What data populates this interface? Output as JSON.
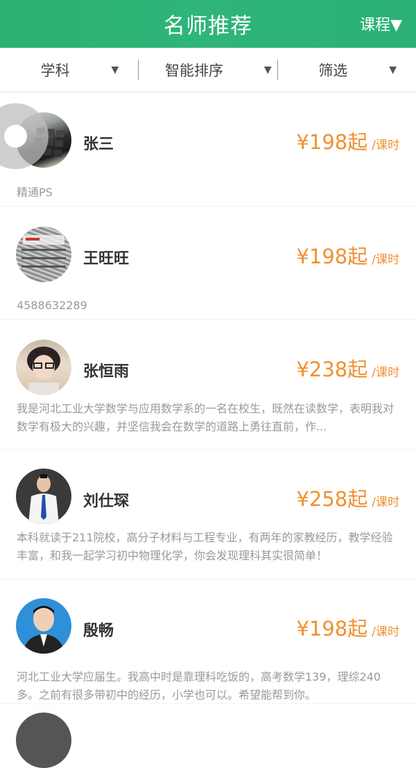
{
  "header": {
    "title": "名师推荐",
    "course_label": "课程▼"
  },
  "filters": [
    {
      "label": "学科",
      "arrow": "▼"
    },
    {
      "label": "智能排序",
      "arrow": "▼"
    },
    {
      "label": "筛选",
      "arrow": "▼"
    }
  ],
  "teachers": [
    {
      "name": "张三",
      "price": "¥198起",
      "unit": "/课时",
      "desc": "精通PS"
    },
    {
      "name": "王旺旺",
      "price": "¥198起",
      "unit": "/课时",
      "desc": "4588632289"
    },
    {
      "name": "张恒雨",
      "price": "¥238起",
      "unit": "/课时",
      "desc": "我是河北工业大学数学与应用数学系的一名在校生，既然在读数学，表明我对数学有极大的兴趣，并坚信我会在数学的道路上勇往直前，作..."
    },
    {
      "name": "刘仕琛",
      "price": "¥258起",
      "unit": "/课时",
      "desc": "本科就读于211院校，高分子材料与工程专业，有两年的家教经历，教学经验丰富，和我一起学习初中物理化学，你会发现理科其实很简单！"
    },
    {
      "name": "殷畅",
      "price": "¥198起",
      "unit": "/课时",
      "desc": "河北工业大学应届生。我高中时是靠理科吃饭的，高考数学139，理综240多。之前有很多带初中的经历，小学也可以。希望能帮到你。"
    }
  ]
}
